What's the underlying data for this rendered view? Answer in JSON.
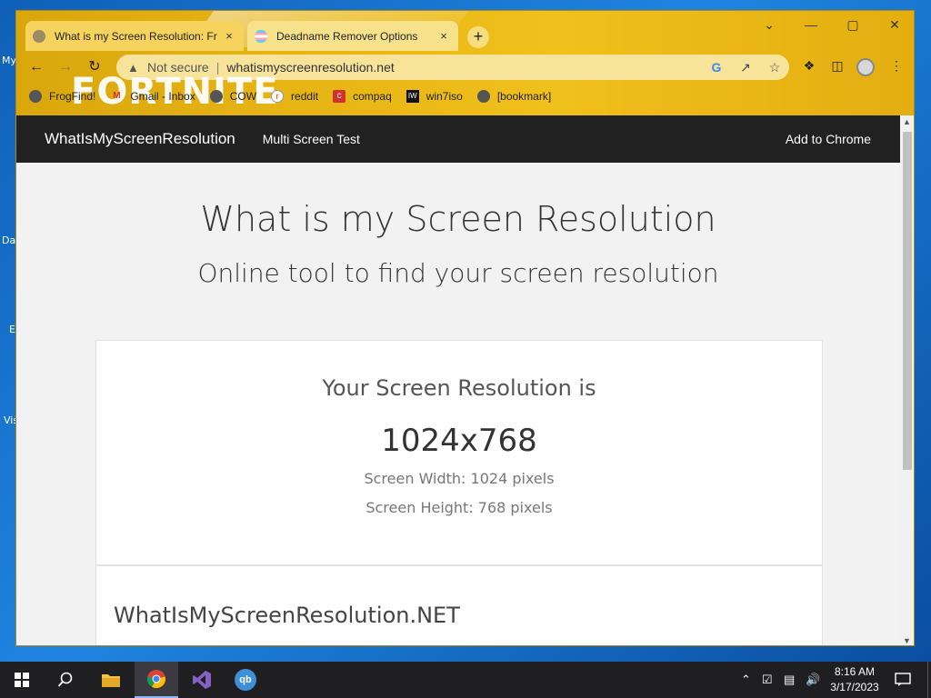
{
  "desktop": {
    "icons": [
      "My",
      "Da",
      "E",
      "Vis"
    ]
  },
  "window": {
    "tabs": [
      {
        "title": "What is my Screen Resolution: Fr",
        "close": "×"
      },
      {
        "title": "Deadname Remover Options",
        "close": "×"
      }
    ],
    "new_tab": "+",
    "controls": {
      "minimize": "—",
      "restore": "▢",
      "close": "✕",
      "tab_search": "⌄"
    }
  },
  "toolbar": {
    "security_label": "Not secure",
    "url": "whatismyscreenresolution.net"
  },
  "bookmarks": [
    {
      "label": "FrogFind!"
    },
    {
      "label": "Gmail - Inbox"
    },
    {
      "label": "COW"
    },
    {
      "label": "reddit"
    },
    {
      "label": "compaq"
    },
    {
      "label": "win7iso"
    },
    {
      "label": "[bookmark]"
    }
  ],
  "theme_overlay": "FORTNITE",
  "page": {
    "navbar": {
      "brand": "WhatIsMyScreenResolution",
      "link": "Multi Screen Test",
      "cta": "Add to Chrome"
    },
    "heading": "What is my Screen Resolution",
    "subheading": "Online tool to find your screen resolution",
    "result_card": {
      "title": "Your Screen Resolution is",
      "resolution": "1024x768",
      "width_line": "Screen Width: 1024 pixels",
      "height_line": "Screen Height: 768 pixels"
    },
    "info_card": {
      "title": "WhatIsMyScreenResolution.NET"
    }
  },
  "taskbar": {
    "time": "8:16 AM",
    "date": "3/17/2023"
  },
  "colors": {
    "theme_gold": "#e8b614",
    "navbar_bg": "#212121",
    "taskbar_bg": "#1f1f22"
  }
}
